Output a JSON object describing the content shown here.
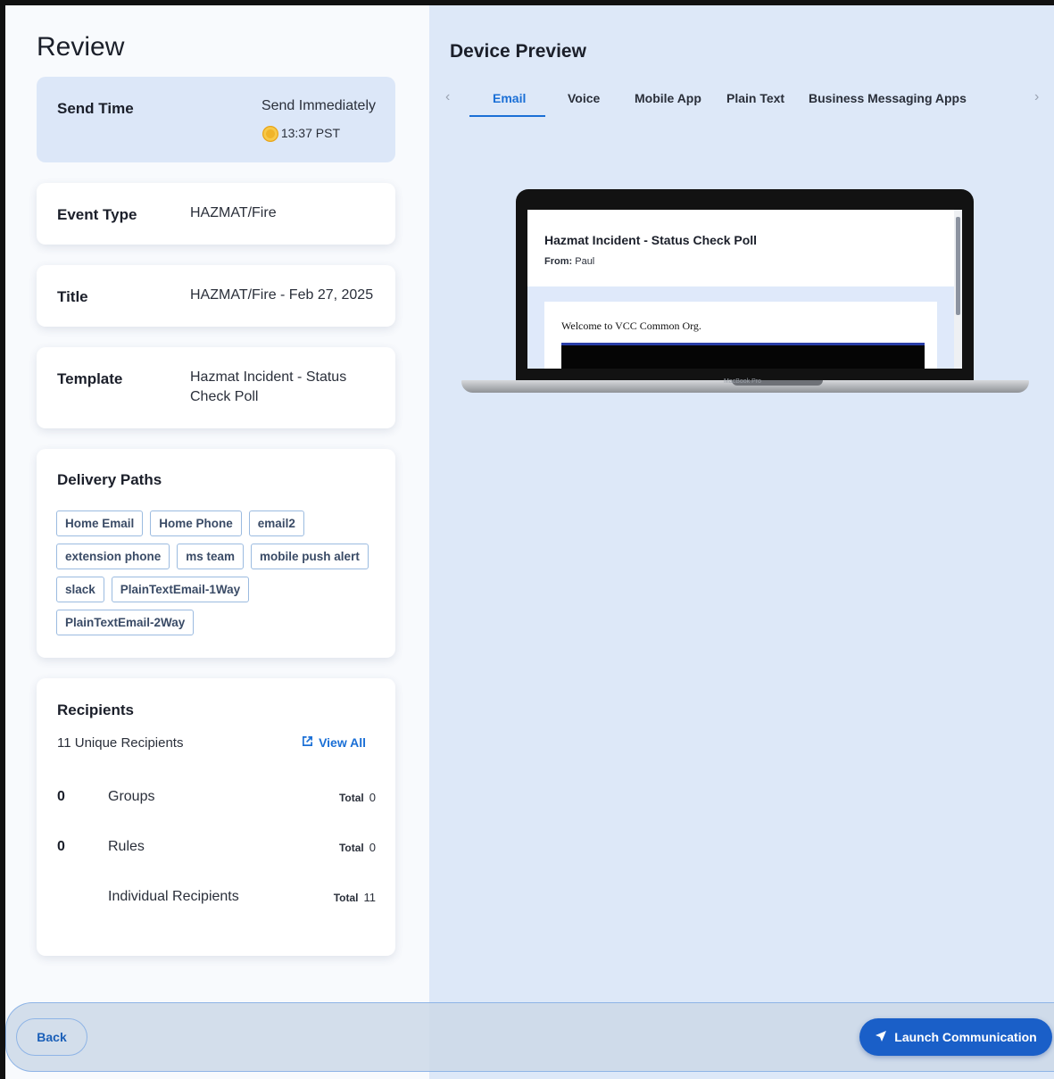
{
  "review": {
    "title": "Review",
    "send_time": {
      "label": "Send Time",
      "value": "Send Immediately",
      "time": "13:37 PST"
    },
    "event_type": {
      "label": "Event Type",
      "value": "HAZMAT/Fire"
    },
    "title_card": {
      "label": "Title",
      "value": "HAZMAT/Fire - Feb 27, 2025"
    },
    "template": {
      "label": "Template",
      "value": "Hazmat Incident - Status Check Poll"
    },
    "delivery_paths": {
      "label": "Delivery Paths",
      "items": [
        "Home Email",
        "Home Phone",
        "email2",
        "extension phone",
        "ms team",
        "mobile push alert",
        "slack",
        "PlainTextEmail-1Way",
        "PlainTextEmail-2Way"
      ]
    },
    "recipients": {
      "label": "Recipients",
      "unique": "11 Unique Recipients",
      "view_all": "View All",
      "total_label": "Total",
      "rows": [
        {
          "count": "0",
          "name": "Groups",
          "total": "0"
        },
        {
          "count": "0",
          "name": "Rules",
          "total": "0"
        },
        {
          "count": "",
          "name": "Individual Recipients",
          "total": "11"
        }
      ]
    }
  },
  "preview": {
    "title": "Device Preview",
    "tabs": [
      "Email",
      "Voice",
      "Mobile App",
      "Plain Text",
      "Business Messaging Apps"
    ],
    "active_tab": "Email",
    "email": {
      "subject": "Hazmat Incident - Status Check Poll",
      "from_label": "From:",
      "from": "Paul",
      "welcome": "Welcome to VCC Common Org."
    },
    "device_label": "MacBook Pro"
  },
  "footer": {
    "back": "Back",
    "launch": "Launch Communication"
  },
  "colors": {
    "accent": "#1a6fd6",
    "primary_button": "#1a5fc8",
    "preview_bg": "#dde8f8",
    "send_card_bg": "#dce7f8"
  },
  "icons": {
    "time_icon": "sun-icon",
    "view_all_icon": "external-link-icon",
    "launch_icon": "send-icon"
  }
}
